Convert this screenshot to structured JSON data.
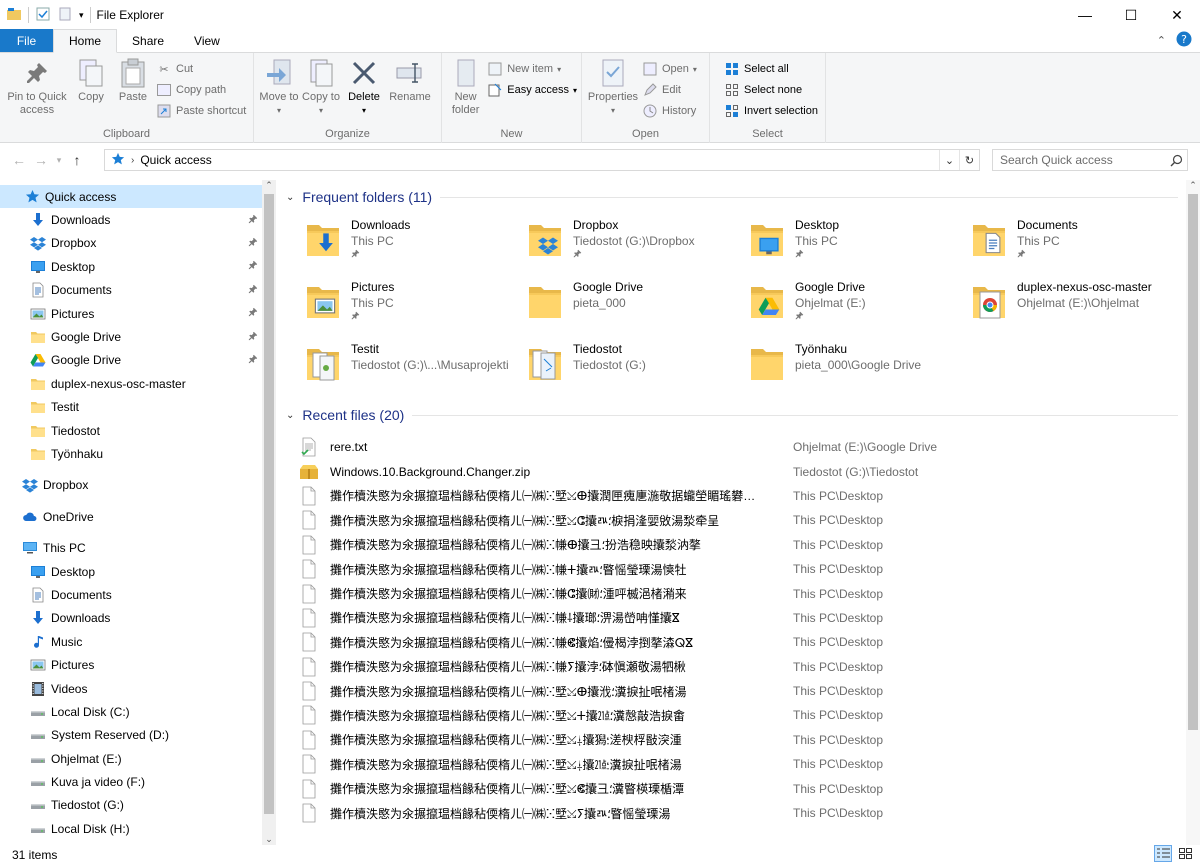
{
  "window": {
    "title": "File Explorer"
  },
  "ribbon_tabs": {
    "file": "File",
    "home": "Home",
    "share": "Share",
    "view": "View"
  },
  "ribbon": {
    "clipboard": {
      "label": "Clipboard",
      "pin": "Pin to Quick access",
      "copy": "Copy",
      "paste": "Paste",
      "cut": "Cut",
      "copy_path": "Copy path",
      "paste_shortcut": "Paste shortcut"
    },
    "organize": {
      "label": "Organize",
      "move_to": "Move to",
      "copy_to": "Copy to",
      "delete": "Delete",
      "rename": "Rename"
    },
    "new": {
      "label": "New",
      "new_folder": "New folder",
      "new_item": "New item",
      "easy_access": "Easy access"
    },
    "open": {
      "label": "Open",
      "properties": "Properties",
      "open": "Open",
      "edit": "Edit",
      "history": "History"
    },
    "select": {
      "label": "Select",
      "select_all": "Select all",
      "select_none": "Select none",
      "invert": "Invert selection"
    }
  },
  "address": {
    "crumb": "Quick access",
    "search_placeholder": "Search Quick access"
  },
  "nav": {
    "quick_access": "Quick access",
    "qa_items": [
      {
        "label": "Downloads",
        "icon": "download-icon"
      },
      {
        "label": "Dropbox",
        "icon": "dropbox-icon"
      },
      {
        "label": "Desktop",
        "icon": "desktop-icon"
      },
      {
        "label": "Documents",
        "icon": "documents-icon"
      },
      {
        "label": "Pictures",
        "icon": "pictures-icon"
      },
      {
        "label": "Google Drive",
        "icon": "folder-icon"
      },
      {
        "label": "Google Drive",
        "icon": "google-drive-icon"
      },
      {
        "label": "duplex-nexus-osc-master",
        "icon": "folder-icon"
      },
      {
        "label": "Testit",
        "icon": "folder-icon"
      },
      {
        "label": "Tiedostot",
        "icon": "folder-icon"
      },
      {
        "label": "Työnhaku",
        "icon": "folder-icon"
      }
    ],
    "dropbox": "Dropbox",
    "onedrive": "OneDrive",
    "this_pc": "This PC",
    "pc_items": [
      {
        "label": "Desktop",
        "icon": "desktop-icon"
      },
      {
        "label": "Documents",
        "icon": "documents-icon"
      },
      {
        "label": "Downloads",
        "icon": "download-icon"
      },
      {
        "label": "Music",
        "icon": "music-icon"
      },
      {
        "label": "Pictures",
        "icon": "pictures-icon"
      },
      {
        "label": "Videos",
        "icon": "videos-icon"
      },
      {
        "label": "Local Disk (C:)",
        "icon": "drive-icon"
      },
      {
        "label": "System Reserved (D:)",
        "icon": "drive-icon"
      },
      {
        "label": "Ohjelmat (E:)",
        "icon": "drive-icon"
      },
      {
        "label": "Kuva ja video (F:)",
        "icon": "drive-icon"
      },
      {
        "label": "Tiedostot (G:)",
        "icon": "drive-icon"
      },
      {
        "label": "Local Disk (H:)",
        "icon": "drive-icon"
      }
    ]
  },
  "frequent": {
    "heading": "Frequent folders (11)",
    "items": [
      {
        "name": "Downloads",
        "loc": "This PC",
        "overlay": "download"
      },
      {
        "name": "Dropbox",
        "loc": "Tiedostot (G:)\\Dropbox",
        "overlay": "dropbox"
      },
      {
        "name": "Desktop",
        "loc": "This PC",
        "overlay": "desktop"
      },
      {
        "name": "Documents",
        "loc": "This PC",
        "overlay": "document"
      },
      {
        "name": "Pictures",
        "loc": "This PC",
        "overlay": "picture"
      },
      {
        "name": "Google Drive",
        "loc": "pieta_000",
        "overlay": "none"
      },
      {
        "name": "Google Drive",
        "loc": "Ohjelmat (E:)",
        "overlay": "gdrive"
      },
      {
        "name": "duplex-nexus-osc-master",
        "loc": "Ohjelmat (E:)\\Ohjelmat",
        "overlay": "chrome"
      },
      {
        "name": "Testit",
        "loc": "Tiedostot (G:)\\...\\Musaprojekti",
        "overlay": "pages"
      },
      {
        "name": "Tiedostot",
        "loc": "Tiedostot (G:)",
        "overlay": "pages2"
      },
      {
        "name": "Työnhaku",
        "loc": "pieta_000\\Google Drive",
        "overlay": "none"
      }
    ]
  },
  "recent": {
    "heading": "Recent files (20)",
    "items": [
      {
        "name": "rere.txt",
        "path": "Ohjelmat (E:)\\Google Drive",
        "icon": "txt"
      },
      {
        "name": "Windows.10.Background.Changer.zip",
        "path": "Tiedostot (G:)\\Tiedostot",
        "icon": "zip"
      },
      {
        "name": "攤作櫝泆愍为氽搌攛瑥档餯秥偄楕ㄦ㈠㈱ⵘ㙒⤩ⴲ攮潤匣瘣㐣湤敬据蠬塋睸瑤礬攮塰",
        "path": "This PC\\Desktop",
        "icon": "blank"
      },
      {
        "name": "攤作櫝泆愍为氽搌攛瑥档餯秥偄楕ㄦ㈠㈱ⵘ㙒⤩ⵛ攮ㅩ⸵棙捐湰婯敓湯湬牵呈",
        "path": "This PC\\Desktop",
        "icon": "blank"
      },
      {
        "name": "攤作櫝泆愍为氽搌攛瑥档餯秥偄楕ㄦ㈠㈱ⵘ㡘ⴲ攮⼹⸵扮浩稳映攮湬汭摮",
        "path": "This PC\\Desktop",
        "icon": "blank"
      },
      {
        "name": "攤作櫝泆愍为氽搌攛瑥档餯秥偄楕ㄦ㈠㈱ⵘ㡘ⵜ攮ㅩ⸵睯愮瑩瑮湯慡牡",
        "path": "This PC\\Desktop",
        "icon": "blank"
      },
      {
        "name": "攤作櫝泆愍为氽搌攛瑥档餯秥偄楕ㄦ㈠㈱ⵘ㡘ⵛ攮㈶⸵湩呯楲浥楮潲来",
        "path": "This PC\\Desktop",
        "icon": "blank"
      },
      {
        "name": "攤作櫝泆愍为氽搌攛瑥档餯秥偄楕ㄦ㈠㈱ⵘ㡘⸸攮瑯⸵淠湯嵤呥慬攮ⴵ",
        "path": "This PC\\Desktop",
        "icon": "blank"
      },
      {
        "name": "攤作櫝泆愍为氽搌攛瑥档餯秥偄楕ㄦ㈠㈱ⵘ㡘ⵞ攮焰⸵㑴楬浡捯摮潹ⵕⴵ",
        "path": "This PC\\Desktop",
        "icon": "blank"
      },
      {
        "name": "攤作櫝泆愍为氽搌攛瑥档餯秥偄楕ㄦ㈠㈱ⵘ㡘ⵢ攮浡⸵砵愼瀬敬湯牭楸",
        "path": "This PC\\Desktop",
        "icon": "blank"
      },
      {
        "name": "攤作櫝泆愍为氽搌攛瑥档餯秥偄楕ㄦ㈠㈱ⵘ㙒⤩ⴲ攮浌⸵瀵捩扯呡楮湯",
        "path": "This PC\\Desktop",
        "icon": "blank"
      },
      {
        "name": "攤作櫝泆愍为氽搌攛瑥档餯秥偄楕ㄦ㈠㈱ⵘ㙒⤩ⵜ攮㍭⸵瀵慤敲浩捩畬",
        "path": "This PC\\Desktop",
        "icon": "blank"
      },
      {
        "name": "攤作櫝泆愍为氽搌攛瑥档餯秥偄楕ㄦ㈠㈱ⵘ㙒⤩⸸攮獡⸵溠楰桴敯湥湩",
        "path": "This PC\\Desktop",
        "icon": "blank"
      },
      {
        "name": "攤作櫝泆愍为氽搌攛瑥档餯秥偄楕ㄦ㈠㈱ⵘ㙒⤩⸸攮㍭⸵瀵捩扯呡楮湯",
        "path": "This PC\\Desktop",
        "icon": "blank"
      },
      {
        "name": "攤作櫝泆愍为氽搌攛瑥档餯秥偄楕ㄦ㈠㈱ⵘ㙒⤩ⵞ攮⼹⸵瀵睯楧瑮楯潭",
        "path": "This PC\\Desktop",
        "icon": "blank"
      },
      {
        "name": "攤作櫝泆愍为氽搌攛瑥档餯秥偄楕ㄦ㈠㈱ⵘ㙒⤩ⵢ攮ㅩ⸵睯愮瑩瑮湯",
        "path": "This PC\\Desktop",
        "icon": "blank"
      }
    ]
  },
  "status": {
    "items_count": "31 items"
  }
}
